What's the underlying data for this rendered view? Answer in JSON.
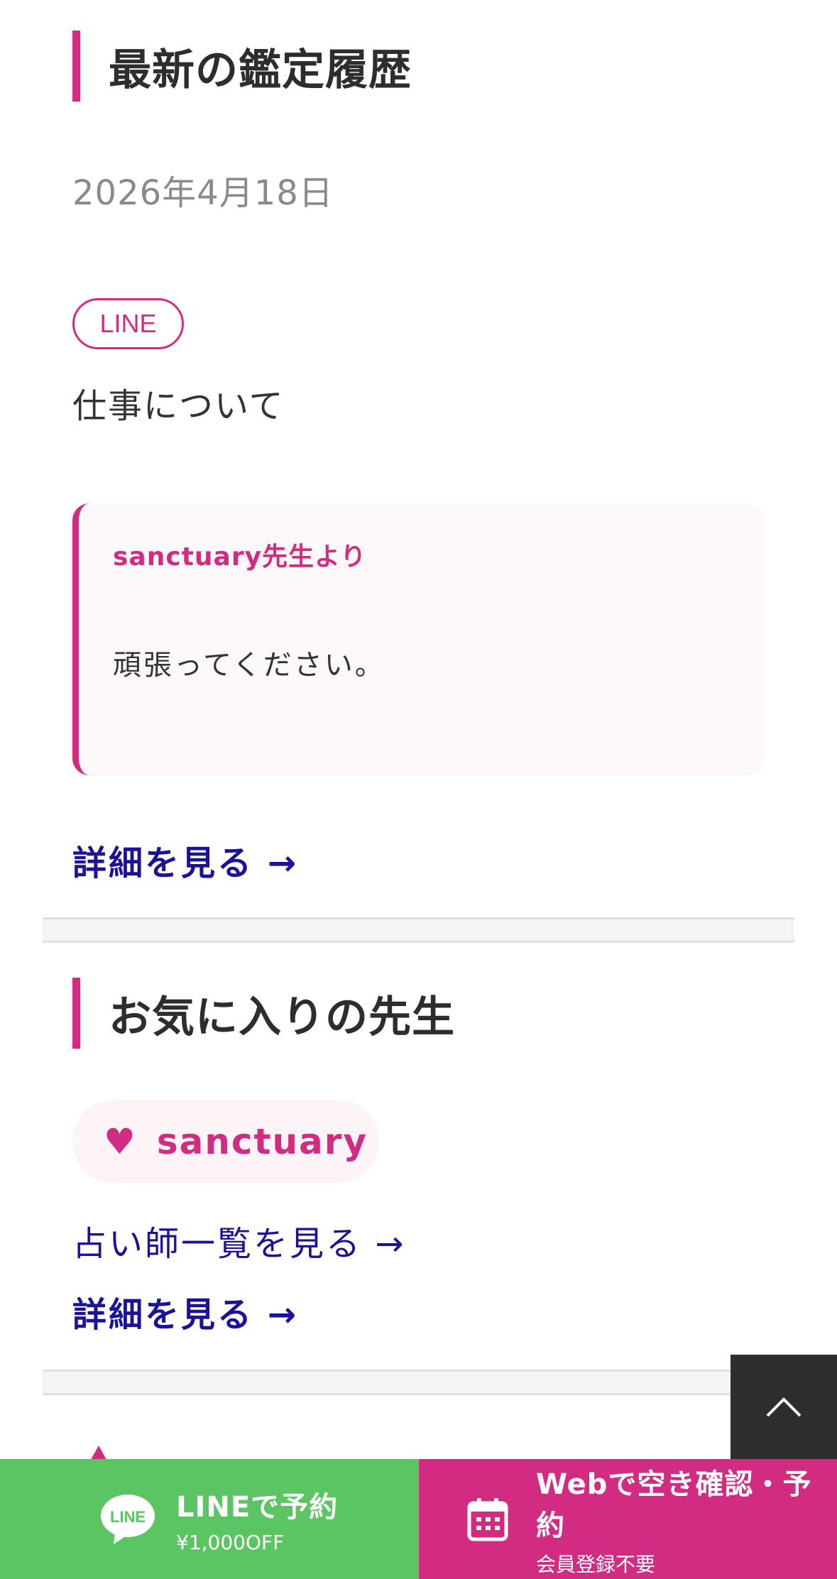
{
  "history": {
    "heading": "最新の鑑定履歴",
    "date": "2026年4月18日",
    "tag": "LINE",
    "topic": "仕事について",
    "message_from": "sanctuary先生より",
    "message_text": "頑張ってください。",
    "detail_link": "詳細を見る →"
  },
  "favorites": {
    "heading": "お気に入りの先生",
    "teacher_name": "sanctuary",
    "heart_glyph": "♥",
    "list_link": "占い師一覧を見る →",
    "detail_link": "詳細を見る →"
  },
  "bottom_bar": {
    "line": {
      "icon_text": "LINE",
      "title": "LINEで予約",
      "subtitle": "¥1,000OFF"
    },
    "web": {
      "title": "Webで空き確認・予約",
      "subtitle": "会員登録不要"
    }
  },
  "colors": {
    "accent": "#d12b82",
    "link": "#1a1399",
    "line_green": "#5ac562",
    "dark": "#2e2e2e"
  },
  "icons": {
    "back_to_top": "chevron-up-icon",
    "line": "line-logo-icon",
    "calendar": "calendar-icon",
    "heart": "heart-icon"
  }
}
